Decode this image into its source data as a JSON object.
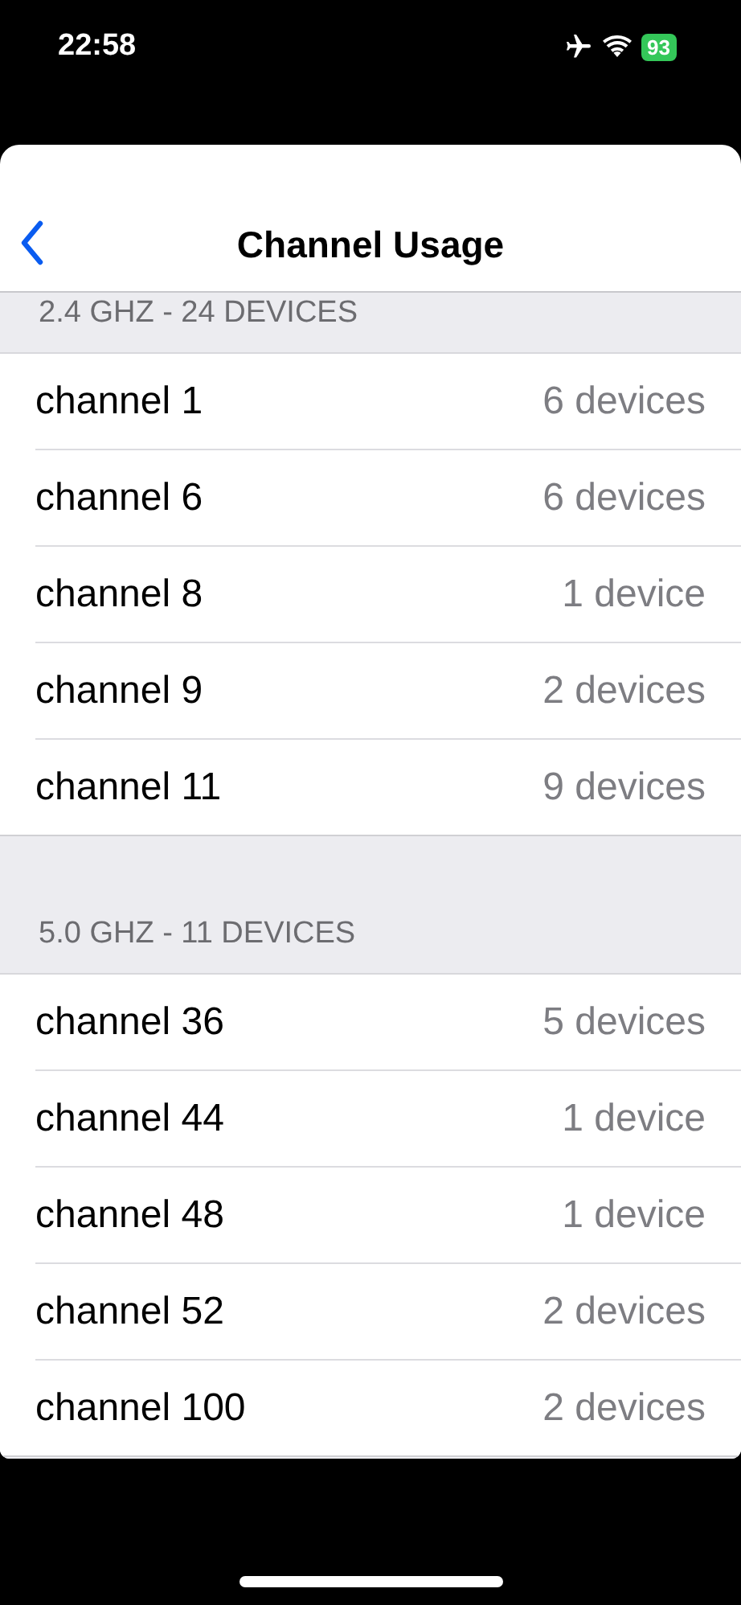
{
  "status_bar": {
    "time": "22:58",
    "battery": "93"
  },
  "nav": {
    "title": "Channel Usage"
  },
  "sections": [
    {
      "header": "2.4 GHZ - 24 DEVICES",
      "rows": [
        {
          "label": "channel 1",
          "value": "6 devices"
        },
        {
          "label": "channel 6",
          "value": "6 devices"
        },
        {
          "label": "channel 8",
          "value": "1 device"
        },
        {
          "label": "channel 9",
          "value": "2 devices"
        },
        {
          "label": "channel 11",
          "value": "9 devices"
        }
      ]
    },
    {
      "header": "5.0 GHZ - 11 DEVICES",
      "rows": [
        {
          "label": "channel 36",
          "value": "5 devices"
        },
        {
          "label": "channel 44",
          "value": "1 device"
        },
        {
          "label": "channel 48",
          "value": "1 device"
        },
        {
          "label": "channel 52",
          "value": "2 devices"
        },
        {
          "label": "channel 100",
          "value": "2 devices"
        }
      ]
    }
  ]
}
